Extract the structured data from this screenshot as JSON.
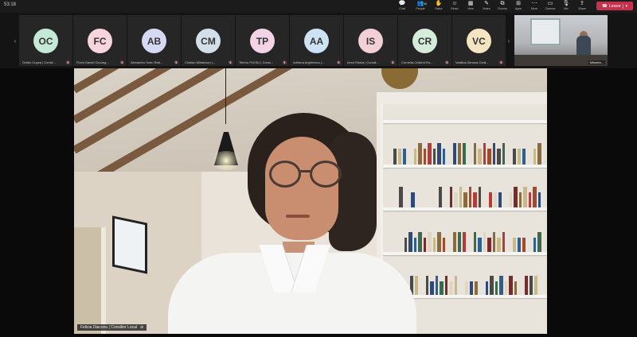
{
  "meeting": {
    "timer": "53:18"
  },
  "toolbar": [
    {
      "key": "chat",
      "label": "Chat",
      "icon": "chat-icon",
      "glyph": "💬"
    },
    {
      "key": "people",
      "label": "People",
      "icon": "people-icon",
      "glyph": "👥",
      "count": "40"
    },
    {
      "key": "raise",
      "label": "Raise",
      "icon": "hand-icon",
      "glyph": "✋"
    },
    {
      "key": "react",
      "label": "React",
      "icon": "smile-icon",
      "glyph": "☺"
    },
    {
      "key": "view",
      "label": "View",
      "icon": "grid-icon",
      "glyph": "▦"
    },
    {
      "key": "notes",
      "label": "Notes",
      "icon": "notes-icon",
      "glyph": "✎"
    },
    {
      "key": "rooms",
      "label": "Rooms",
      "icon": "rooms-icon",
      "glyph": "⧉"
    },
    {
      "key": "apps",
      "label": "Apps",
      "icon": "apps-icon",
      "glyph": "⊞"
    },
    {
      "key": "more",
      "label": "More",
      "icon": "more-icon",
      "glyph": "⋯"
    },
    {
      "key": "camera",
      "label": "Camera",
      "icon": "camera-icon",
      "glyph": "▭"
    },
    {
      "key": "mic",
      "label": "Mic",
      "icon": "mic-icon",
      "glyph": "🎙"
    },
    {
      "key": "share",
      "label": "Share",
      "icon": "share-icon",
      "glyph": "⇪"
    }
  ],
  "leave": {
    "label": "Leave"
  },
  "participants": [
    {
      "initials": "OC",
      "name": "Ovidiu Cupsa | Consil...",
      "color": "#c5e8d7"
    },
    {
      "initials": "FC",
      "name": "Florin Daniel Ciucarg...",
      "color": "#f6d5dc"
    },
    {
      "initials": "AB",
      "name": "Alexandru Sorin Rad...",
      "color": "#d6d9f3"
    },
    {
      "initials": "CM",
      "name": "Cristian Mihalescu |...",
      "color": "#d3dfe9"
    },
    {
      "initials": "TP",
      "name": "Tiberiu PLEȘU | Consi...",
      "color": "#f3d4e7"
    },
    {
      "initials": "AA",
      "name": "Adriana Arghirescu |...",
      "color": "#cde2f3"
    },
    {
      "initials": "IS",
      "name": "Ionut Stoica | Consili...",
      "color": "#f3cfd6"
    },
    {
      "initials": "CR",
      "name": "Cornelia-Cristina Ru...",
      "color": "#d4ecd9"
    },
    {
      "initials": "VC",
      "name": "Vasilica-Simona Ocră...",
      "color": "#f5e4c2"
    }
  ],
  "video_participant": {
    "name": "Mihaela..."
  },
  "stage": {
    "speaker_name": "Felicia Diaconu | Consilier Local"
  },
  "colors": {
    "leave": "#c4314b",
    "bar": "#1b1b1b"
  }
}
